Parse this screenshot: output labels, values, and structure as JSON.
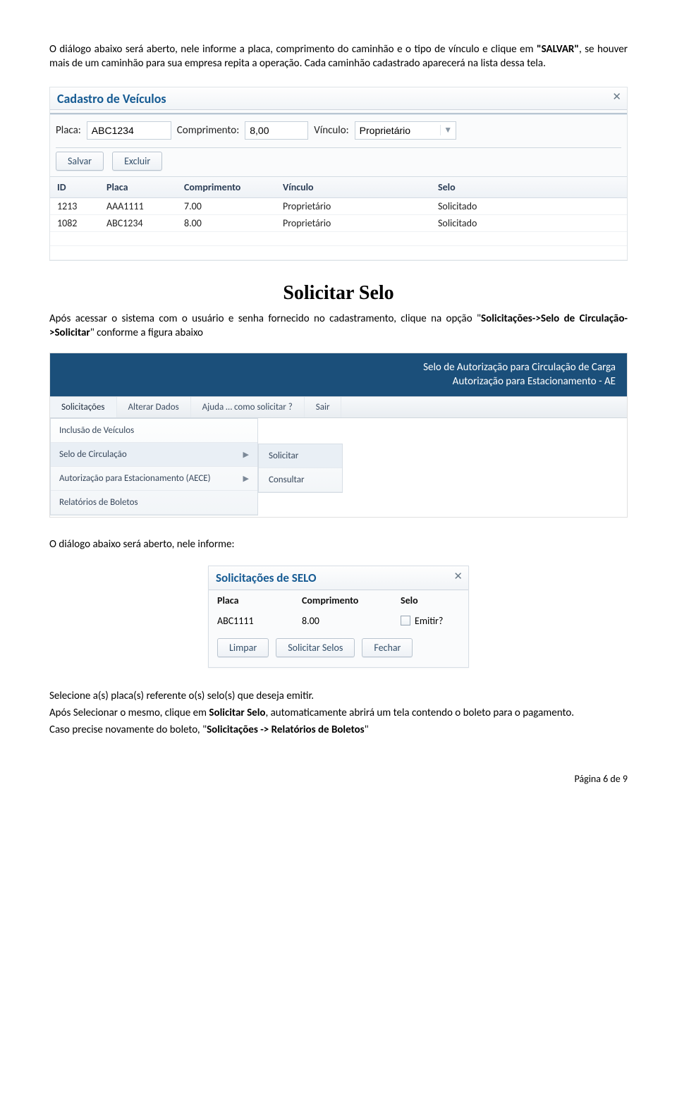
{
  "intro": {
    "p1a": "O diálogo abaixo será aberto, nele informe a placa, comprimento do caminhão e o tipo de vínculo e  clique em ",
    "p1b": "SALVAR",
    "p1c": ", se houver mais de um caminhão para sua empresa repita a operação. Cada caminhão cadastrado aparecerá na lista dessa tela."
  },
  "dialog1": {
    "title": "Cadastro de Veículos",
    "labels": {
      "placa": "Placa:",
      "comp": "Comprimento:",
      "vinc": "Vínculo:"
    },
    "values": {
      "placa": "ABC1234",
      "comp": "8,00",
      "vinc": "Proprietário"
    },
    "buttons": {
      "salvar": "Salvar",
      "excluir": "Excluir"
    },
    "headers": {
      "id": "ID",
      "placa": "Placa",
      "comp": "Comprimento",
      "vinc": "Vínculo",
      "selo": "Selo"
    },
    "rows": [
      {
        "id": "1213",
        "placa": "AAA1111",
        "comp": "7.00",
        "vinc": "Proprietário",
        "selo": "Solicitado"
      },
      {
        "id": "1082",
        "placa": "ABC1234",
        "comp": "8.00",
        "vinc": "Proprietário",
        "selo": "Solicitado"
      }
    ]
  },
  "section_title": "Solicitar Selo",
  "midtext": {
    "a": "Após acessar o sistema com o usuário e senha fornecido no cadastramento, clique na opção ",
    "b": "Solicitações->Selo de Circulação->Solicitar",
    "c": " conforme a figura abaixo"
  },
  "banner": {
    "l1": "Selo de Autorização para Circulação de Carga",
    "l2": "Autorização para Estacionamento - AE"
  },
  "menubar": [
    "Solicitações",
    "Alterar Dados",
    "Ajuda … como solicitar ?",
    "Sair"
  ],
  "dropdown": [
    "Inclusão de Veículos",
    "Selo de Circulação",
    "Autorização para Estacionamento (AECE)",
    "Relatórios de Boletos"
  ],
  "flyout": [
    "Solicitar",
    "Consultar"
  ],
  "after_menu": "O diálogo abaixo será aberto, nele informe:",
  "dialog2": {
    "title": "Solicitações de SELO",
    "headers": {
      "placa": "Placa",
      "comp": "Comprimento",
      "selo": "Selo"
    },
    "row": {
      "placa": "ABC1111",
      "comp": "8.00",
      "emit": "Emitir?"
    },
    "buttons": {
      "limpar": "Limpar",
      "solsel": "Solicitar Selos",
      "fechar": "Fechar"
    }
  },
  "bottom": {
    "p1": "Selecione  a(s)  placa(s)  referente  o(s) selo(s)  que deseja emitir.",
    "p2a": "Após Selecionar o mesmo,  clique em ",
    "p2b": "Solicitar Selo",
    "p2c": ", automaticamente abrirá um tela contendo o boleto para o pagamento.",
    "p3a": "Caso precise novamente do boleto, ",
    "p3b": "Solicitações -> Relatórios de Boletos"
  },
  "footer": "Página 6 de 9"
}
